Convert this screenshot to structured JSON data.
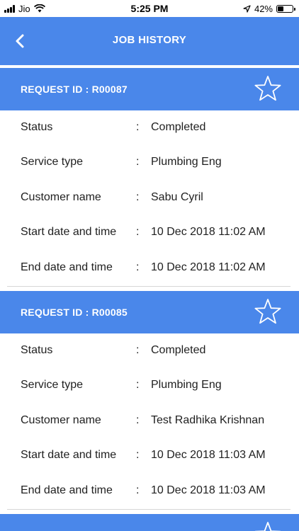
{
  "status_bar": {
    "carrier": "Jio",
    "time": "5:25 PM",
    "battery": "42%",
    "battery_level": 0.42,
    "icons": [
      "signal-icon",
      "wifi-icon",
      "location-arrow-icon",
      "battery-icon"
    ]
  },
  "header": {
    "title": "JOB HISTORY",
    "back_icon": "chevron-left-icon"
  },
  "colors": {
    "accent": "#4a87ea",
    "text": "#1f1f1f",
    "divider": "#d6d6d6"
  },
  "jobs": [
    {
      "request_label": "REQUEST ID : R00087",
      "star_icon": "star-outline-icon",
      "fields": [
        {
          "label": "Status",
          "sep": ":",
          "value": "Completed"
        },
        {
          "label": "Service type",
          "sep": ":",
          "value": "Plumbing Eng"
        },
        {
          "label": "Customer name",
          "sep": ":",
          "value": "Sabu Cyril"
        },
        {
          "label": "Start date and time",
          "sep": ":",
          "value": "10 Dec 2018 11:02 AM"
        },
        {
          "label": "End date and time",
          "sep": ":",
          "value": "10 Dec 2018 11:02 AM"
        }
      ]
    },
    {
      "request_label": "REQUEST ID : R00085",
      "star_icon": "star-outline-icon",
      "fields": [
        {
          "label": "Status",
          "sep": ":",
          "value": "Completed"
        },
        {
          "label": "Service type",
          "sep": ":",
          "value": "Plumbing Eng"
        },
        {
          "label": "Customer name",
          "sep": ":",
          "value": "Test Radhika Krishnan"
        },
        {
          "label": "Start date and time",
          "sep": ":",
          "value": "10 Dec 2018 11:03 AM"
        },
        {
          "label": "End date and time",
          "sep": ":",
          "value": "10 Dec 2018 11:03 AM"
        }
      ]
    }
  ]
}
